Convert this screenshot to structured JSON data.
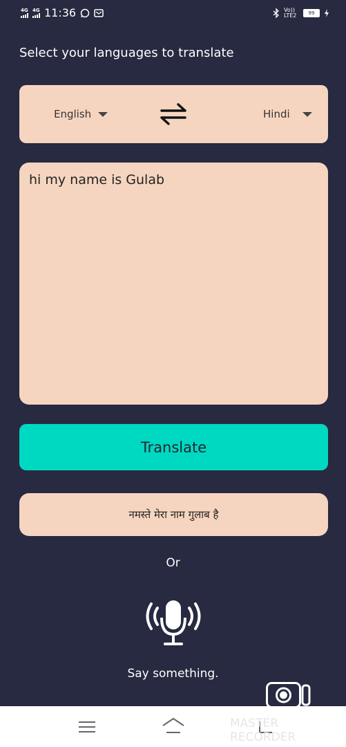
{
  "status_bar": {
    "network1": "4G",
    "network2": "4G",
    "time": "11:36",
    "volte": "Vo)) LTE2",
    "battery": "99",
    "icons": [
      "whatsapp-icon",
      "message-icon",
      "bluetooth-icon",
      "charging-icon"
    ]
  },
  "heading": "Select your languages to translate",
  "languages": {
    "source": "English",
    "target": "Hindi",
    "swap_icon": "swap-arrows-icon"
  },
  "input": {
    "value": "hi my name is Gulab"
  },
  "translate_button": "Translate",
  "result": "नमस्ते मेरा नाम गुलाब है",
  "or_label": "Or",
  "mic_icon": "microphone-icon",
  "say_label": "Say something.",
  "nav": {
    "icons": [
      "menu-icon",
      "home-icon",
      "back-icon"
    ]
  },
  "recorder": {
    "watermark": "MASTER RECORDER"
  },
  "colors": {
    "background": "#272a40",
    "card": "#f6d5c0",
    "accent": "#00d9c2"
  }
}
